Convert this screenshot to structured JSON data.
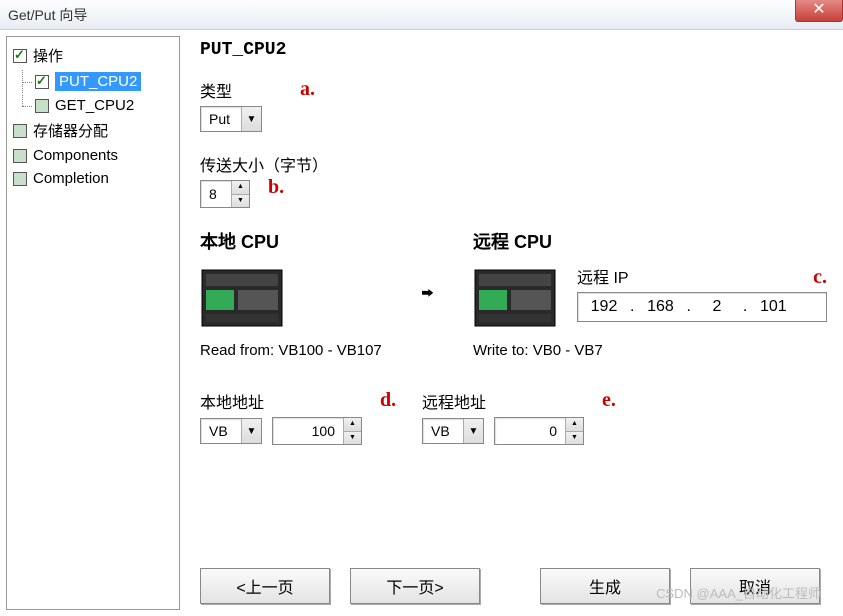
{
  "window": {
    "title": "Get/Put 向导",
    "close": "✕"
  },
  "sidebar": {
    "items": [
      {
        "label": "操作",
        "checked": true
      },
      {
        "label": "PUT_CPU2",
        "checked": true,
        "selected": true
      },
      {
        "label": "GET_CPU2",
        "checked": false
      },
      {
        "label": "存储器分配",
        "checked": false
      },
      {
        "label": "Components",
        "checked": false
      },
      {
        "label": "Completion",
        "checked": false
      }
    ]
  },
  "main": {
    "title": "PUT_CPU2",
    "type_label": "类型",
    "type_value": "Put",
    "size_label": "传送大小（字节）",
    "size_value": "8",
    "local_cpu_label": "本地 CPU",
    "remote_cpu_label": "远程 CPU",
    "remote_ip_label": "远程 IP",
    "ip": {
      "o1": "192",
      "o2": "168",
      "o3": "2",
      "o4": "101"
    },
    "read_from": "Read from: VB100 - VB107",
    "write_to": "Write to: VB0 - VB7",
    "local_addr_label": "本地地址",
    "local_addr_type": "VB",
    "local_addr_val": "100",
    "remote_addr_label": "远程地址",
    "remote_addr_type": "VB",
    "remote_addr_val": "0"
  },
  "annotations": {
    "a": "a.",
    "b": "b.",
    "c": "c.",
    "d": "d.",
    "e": "e."
  },
  "buttons": {
    "prev": "<上一页",
    "next": "下一页>",
    "generate": "生成",
    "cancel": "取消"
  },
  "watermark": "CSDN @AAA_自动化工程师"
}
